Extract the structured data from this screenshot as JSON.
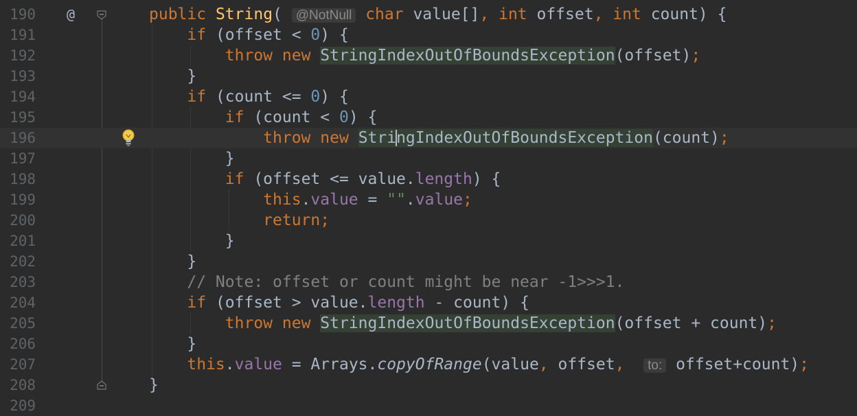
{
  "editor": {
    "lines": [
      {
        "n": "190",
        "t": [
          [
            "public",
            "kw"
          ],
          [
            " "
          ],
          [
            "String",
            "fn"
          ],
          [
            "( "
          ],
          [
            "@NotNull",
            "hint"
          ],
          [
            " "
          ],
          [
            "char",
            "kw"
          ],
          [
            " value[]"
          ],
          [
            ",",
            "kw"
          ],
          [
            " "
          ],
          [
            "int",
            "kw"
          ],
          [
            " offset"
          ],
          [
            ",",
            "kw"
          ],
          [
            " "
          ],
          [
            "int",
            "kw"
          ],
          [
            " count) {"
          ]
        ]
      },
      {
        "n": "191",
        "t": [
          [
            "    "
          ],
          [
            "if",
            "kw"
          ],
          [
            " (offset < "
          ],
          [
            "0",
            "num"
          ],
          [
            ") {"
          ]
        ]
      },
      {
        "n": "192",
        "t": [
          [
            "        "
          ],
          [
            "throw",
            "kw"
          ],
          [
            " "
          ],
          [
            "new",
            "kw"
          ],
          [
            " "
          ],
          [
            "StringIndexOutOfBoundsException",
            "cls"
          ],
          [
            "(offset)"
          ],
          [
            ";",
            "kw"
          ]
        ]
      },
      {
        "n": "193",
        "t": [
          [
            "    }"
          ]
        ]
      },
      {
        "n": "194",
        "t": [
          [
            "    "
          ],
          [
            "if",
            "kw"
          ],
          [
            " (count <= "
          ],
          [
            "0",
            "num"
          ],
          [
            ") {"
          ]
        ]
      },
      {
        "n": "195",
        "t": [
          [
            "        "
          ],
          [
            "if",
            "kw"
          ],
          [
            " (count < "
          ],
          [
            "0",
            "num"
          ],
          [
            ") {"
          ]
        ]
      },
      {
        "n": "196",
        "t": [
          [
            "            "
          ],
          [
            "throw",
            "kw"
          ],
          [
            " "
          ],
          [
            "new",
            "kw"
          ],
          [
            " "
          ],
          [
            "StringIndexOutOfBoundsException",
            "cls"
          ],
          [
            "(count)"
          ],
          [
            ";",
            "kw"
          ]
        ]
      },
      {
        "n": "197",
        "t": [
          [
            "        }"
          ]
        ]
      },
      {
        "n": "198",
        "t": [
          [
            "        "
          ],
          [
            "if",
            "kw"
          ],
          [
            " (offset <= value."
          ],
          [
            "length",
            "fld"
          ],
          [
            ") {"
          ]
        ]
      },
      {
        "n": "199",
        "t": [
          [
            "            "
          ],
          [
            "this",
            "kw"
          ],
          [
            "."
          ],
          [
            "value",
            "fld"
          ],
          [
            " = "
          ],
          [
            "\"\"",
            "str"
          ],
          [
            "."
          ],
          [
            "value",
            "fld"
          ],
          [
            ";",
            "kw"
          ]
        ]
      },
      {
        "n": "200",
        "t": [
          [
            "            "
          ],
          [
            "return",
            "kw"
          ],
          [
            ";",
            "kw"
          ]
        ]
      },
      {
        "n": "201",
        "t": [
          [
            "        }"
          ]
        ]
      },
      {
        "n": "202",
        "t": [
          [
            "    }"
          ]
        ]
      },
      {
        "n": "203",
        "t": [
          [
            "    "
          ],
          [
            "// Note: offset or count might be near -1>>>1.",
            "cmt"
          ]
        ]
      },
      {
        "n": "204",
        "t": [
          [
            "    "
          ],
          [
            "if",
            "kw"
          ],
          [
            " (offset > value."
          ],
          [
            "length",
            "fld"
          ],
          [
            " - count) {"
          ]
        ]
      },
      {
        "n": "205",
        "t": [
          [
            "        "
          ],
          [
            "throw",
            "kw"
          ],
          [
            " "
          ],
          [
            "new",
            "kw"
          ],
          [
            " "
          ],
          [
            "StringIndexOutOfBoundsException",
            "cls"
          ],
          [
            "(offset + count)"
          ],
          [
            ";",
            "kw"
          ]
        ]
      },
      {
        "n": "206",
        "t": [
          [
            "    }"
          ]
        ]
      },
      {
        "n": "207",
        "t": [
          [
            "    "
          ],
          [
            "this",
            "kw"
          ],
          [
            "."
          ],
          [
            "value",
            "fld"
          ],
          [
            " = Arrays."
          ],
          [
            "copyOfRange",
            "it"
          ],
          [
            "(value"
          ],
          [
            ",",
            "kw"
          ],
          [
            " offset"
          ],
          [
            ",",
            "kw"
          ],
          [
            "  "
          ],
          [
            "to:",
            "hint"
          ],
          [
            " offset+count)"
          ],
          [
            ";",
            "kw"
          ]
        ]
      },
      {
        "n": "208",
        "t": [
          [
            "}"
          ]
        ]
      },
      {
        "n": "209",
        "t": [
          [
            ""
          ]
        ]
      }
    ],
    "current_line": "196",
    "override_marker": "@",
    "caret_after_text": "Stri"
  },
  "colors": {
    "background": "#2b2b2b",
    "current_line": "#323232",
    "keyword": "#cc7832",
    "method": "#ffc66d",
    "number": "#6897bb",
    "field": "#9876aa",
    "comment": "#808080",
    "string": "#6a8759",
    "class_highlight": "#344134"
  }
}
